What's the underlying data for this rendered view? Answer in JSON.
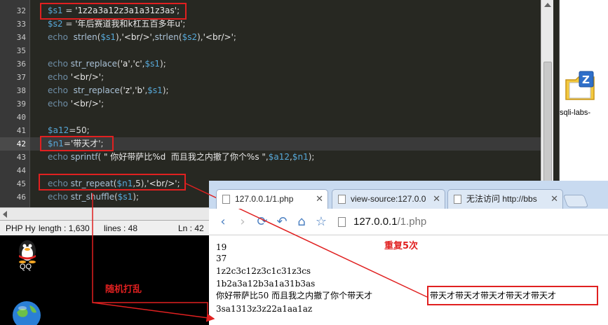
{
  "editor": {
    "lines": [
      {
        "num": "32",
        "text": "$s1 = '1z2a3a12z3a1a31z3as';"
      },
      {
        "num": "33",
        "text": "$s2 = '年后赛道我和k杠五百多年u';"
      },
      {
        "num": "34",
        "text": "echo  strlen($s1),'<br/>',strlen($s2),'<br/>';"
      },
      {
        "num": "35",
        "text": ""
      },
      {
        "num": "36",
        "text": "echo str_replace('a','c',$s1);"
      },
      {
        "num": "37",
        "text": "echo '<br/>';"
      },
      {
        "num": "38",
        "text": "echo  str_replace('z','b',$s1);"
      },
      {
        "num": "39",
        "text": "echo '<br/>';"
      },
      {
        "num": "40",
        "text": ""
      },
      {
        "num": "41",
        "text": "$a12=50;"
      },
      {
        "num": "42",
        "text": "$n1='带天才';"
      },
      {
        "num": "43",
        "text": "echo sprintf( \" 你好带萨比%d  而且我之内撤了你个%s \",$a12,$n1);"
      },
      {
        "num": "44",
        "text": ""
      },
      {
        "num": "45",
        "text": "echo str_repeat($n1,5),'<br/>';"
      },
      {
        "num": "46",
        "text": "echo str_shuffle($s1);"
      }
    ],
    "status": {
      "type": "PHP Hy",
      "length": "length : 1,630",
      "lines": "lines : 48",
      "ln": "Ln : 42"
    }
  },
  "desktop": {
    "right_icon_label": "sqli-labs-",
    "qq_label": "QQ"
  },
  "browser": {
    "tabs": [
      {
        "title": "127.0.0.1/1.php",
        "active": true
      },
      {
        "title": "view-source:127.0.0",
        "active": false
      },
      {
        "title": "无法访问 http://bbs",
        "active": false
      }
    ],
    "url_host": "127.0.0.1",
    "url_path": "/1.php",
    "output": [
      "19",
      "37",
      "1z2c3c12z3c1c31z3cs",
      "1b2a3a12b3a1a31b3as",
      "你好带萨比50 而且我之内撤了你个带天才",
      "带天才带天才带天才带天才带天才",
      "3sa1313z3z22a1aa1az"
    ]
  },
  "annotations": {
    "repeat": "重复5次",
    "shuffle": "随机打乱"
  },
  "colors": {
    "editor_bg": "#272822",
    "annotation_red": "#e02020",
    "tabbar": "#c8daf0"
  }
}
